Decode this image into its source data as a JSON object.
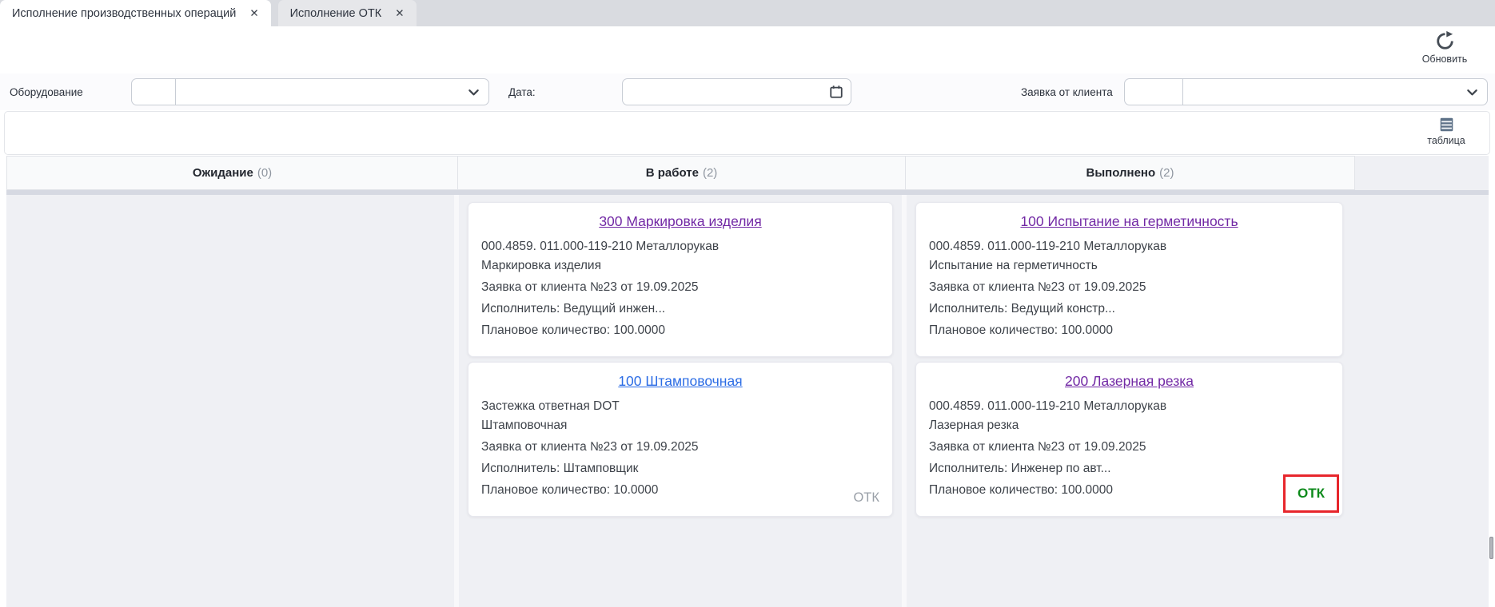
{
  "tabs": [
    {
      "label": "Исполнение производственных операций",
      "close_icon": "✕",
      "active": true
    },
    {
      "label": "Исполнение ОТК",
      "close_icon": "✕",
      "active": false
    }
  ],
  "toolbar": {
    "refresh_label": "Обновить",
    "table_label": "таблица"
  },
  "filters": {
    "equipment": {
      "label": "Оборудование",
      "code_value": "",
      "value": ""
    },
    "date": {
      "label": "Дата:",
      "value": ""
    },
    "client_request": {
      "label": "Заявка от клиента",
      "code_value": "",
      "value": ""
    }
  },
  "board": {
    "columns": [
      {
        "name": "Ожидание",
        "count": "(0)",
        "cards": []
      },
      {
        "name": "В работе",
        "count": "(2)",
        "cards": [
          {
            "title": "300 Маркировка изделия",
            "title_color": "purple",
            "lines": [
              "000.4859. 011.000-119-210 Металлорукав",
              "Маркировка изделия",
              "Заявка от клиента №23 от 19.09.2025",
              "Исполнитель: Ведущий инжен...",
              "Плановое количество: 100.0000"
            ],
            "badge": null
          },
          {
            "title": "100 Штамповочная",
            "title_color": "blue",
            "lines": [
              "Застежка ответная DOT",
              "Штамповочная",
              "Заявка от клиента №23 от 19.09.2025",
              "Исполнитель: Штамповщик",
              "Плановое количество: 10.0000"
            ],
            "badge": {
              "text": "ОТК",
              "style": "plain"
            }
          }
        ]
      },
      {
        "name": "Выполнено",
        "count": "(2)",
        "cards": [
          {
            "title": "100 Испытание на герметичность",
            "title_color": "purple",
            "lines": [
              "000.4859. 011.000-119-210 Металлорукав",
              "Испытание на герметичность",
              "Заявка от клиента №23 от 19.09.2025",
              "Исполнитель: Ведущий констр...",
              "Плановое количество: 100.0000"
            ],
            "badge": null
          },
          {
            "title": "200 Лазерная резка",
            "title_color": "purple",
            "lines": [
              "000.4859. 011.000-119-210 Металлорукав",
              "Лазерная резка",
              "Заявка от клиента №23 от 19.09.2025",
              "Исполнитель: Инженер по авт...",
              "Плановое количество: 100.0000"
            ],
            "badge": {
              "text": "ОТК",
              "style": "qc-passed"
            }
          }
        ]
      }
    ]
  },
  "colors": {
    "link_purple": "#7229a5",
    "link_blue": "#2b6ce5",
    "qc_green": "#0d8a1b",
    "qc_border_red": "#e7262c",
    "badge_gray": "#9aa0a8"
  }
}
